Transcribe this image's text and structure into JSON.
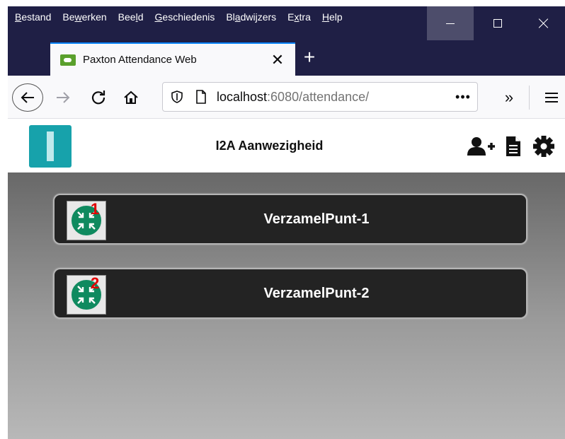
{
  "browser": {
    "menu": [
      {
        "pre": "",
        "key": "B",
        "post": "estand"
      },
      {
        "pre": "Be",
        "key": "w",
        "post": "erken"
      },
      {
        "pre": "Bee",
        "key": "l",
        "post": "d"
      },
      {
        "pre": "",
        "key": "G",
        "post": "eschiedenis"
      },
      {
        "pre": "Bl",
        "key": "a",
        "post": "dwijzers"
      },
      {
        "pre": "E",
        "key": "x",
        "post": "tra"
      },
      {
        "pre": "",
        "key": "H",
        "post": "elp"
      }
    ],
    "tab_title": "Paxton Attendance Web",
    "tab_close_glyph": "✕",
    "newtab_glyph": "+",
    "url_host": "localhost",
    "url_rest": ":6080/attendance/",
    "url_more_glyph": "•••",
    "overflow_glyph": "»",
    "accent_color": "#0a84ff",
    "chrome_color": "#1f1f45"
  },
  "app": {
    "title": "I2A Aanwezigheid",
    "logo_color": "#17a2ab",
    "icons": [
      "add-user-icon",
      "document-icon",
      "gear-icon"
    ],
    "points": [
      {
        "label": "VerzamelPunt-1",
        "number": "1"
      },
      {
        "label": "VerzamelPunt-2",
        "number": "2"
      }
    ],
    "badge_color": "#e00000"
  }
}
